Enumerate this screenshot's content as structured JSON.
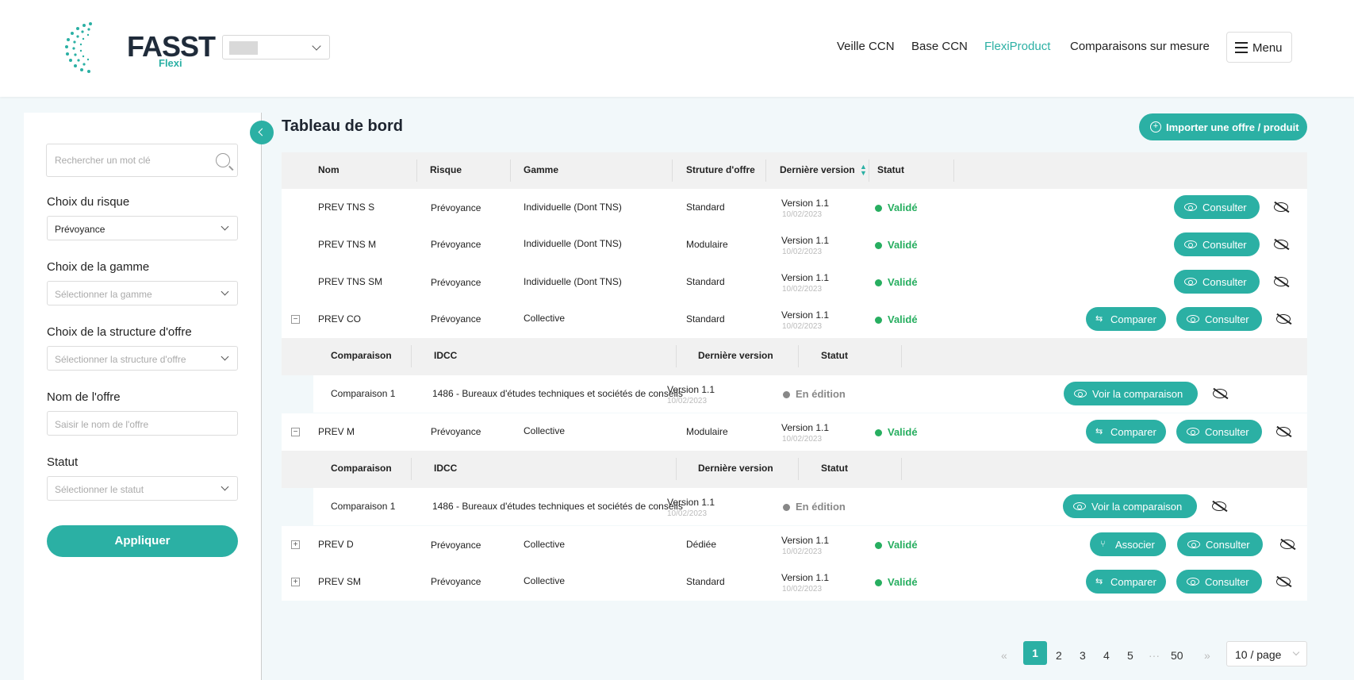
{
  "header": {
    "logo_text": "FASST",
    "logo_sub": "Flexi",
    "nav": [
      "Veille CCN",
      "Base CCN",
      "FlexiProduct",
      "Comparaisons sur mesure"
    ],
    "menu_label": "Menu",
    "accent_color": "#2bb0a4"
  },
  "sidebar": {
    "search_placeholder": "Rechercher un mot clé",
    "risk_label": "Choix du risque",
    "risk_value": "Prévoyance",
    "gamme_label": "Choix de la gamme",
    "gamme_placeholder": "Sélectionner la gamme",
    "structure_label": "Choix de la structure d'offre",
    "structure_placeholder": "Sélectionner la structure d'offre",
    "name_label": "Nom de l'offre",
    "name_placeholder": "Saisir le nom de l'offre",
    "status_label": "Statut",
    "status_placeholder": "Sélectionner le statut",
    "apply_label": "Appliquer"
  },
  "main": {
    "title": "Tableau de bord",
    "import_label": "Importer une offre / produit",
    "columns": [
      "Nom",
      "Risque",
      "Gamme",
      "Struture d'offre",
      "Dernière version",
      "Statut"
    ],
    "sub_columns": [
      "Comparaison",
      "IDCC",
      "Dernière version",
      "Statut"
    ],
    "rows": [
      {
        "name": "PREV TNS S",
        "risk": "Prévoyance",
        "gamme": "Individuelle (Dont TNS)",
        "structure": "Standard",
        "version": "Version 1.1",
        "date": "10/02/2023",
        "status": "Validé"
      },
      {
        "name": "PREV TNS M",
        "risk": "Prévoyance",
        "gamme": "Individuelle (Dont TNS)",
        "structure": "Modulaire",
        "version": "Version 1.1",
        "date": "10/02/2023",
        "status": "Validé"
      },
      {
        "name": "PREV TNS SM",
        "risk": "Prévoyance",
        "gamme": "Individuelle (Dont TNS)",
        "structure": "Standard",
        "version": "Version 1.1",
        "date": "10/02/2023",
        "status": "Validé"
      },
      {
        "name": "PREV CO",
        "risk": "Prévoyance",
        "gamme": "Collective",
        "structure": "Standard",
        "version": "Version 1.1",
        "date": "10/02/2023",
        "status": "Validé"
      },
      {
        "name": "PREV M",
        "risk": "Prévoyance",
        "gamme": "Collective",
        "structure": "Modulaire",
        "version": "Version 1.1",
        "date": "10/02/2023",
        "status": "Validé"
      },
      {
        "name": "PREV D",
        "risk": "Prévoyance",
        "gamme": "Collective",
        "structure": "Dédiée",
        "version": "Version 1.1",
        "date": "10/02/2023",
        "status": "Validé"
      },
      {
        "name": "PREV SM",
        "risk": "Prévoyance",
        "gamme": "Collective",
        "structure": "Standard",
        "version": "Version 1.1",
        "date": "10/02/2023",
        "status": "Validé"
      }
    ],
    "comparison": {
      "name": "Comparaison 1",
      "idcc": "1486 - Bureaux d'études techniques et sociétés de conseils",
      "version": "Version 1.1",
      "date": "10/02/2023",
      "status": "En édition"
    },
    "buttons": {
      "consult": "Consulter",
      "compare": "Comparer",
      "associate": "Associer",
      "view_comparison": "Voir la comparaison"
    },
    "expander_minus": "−",
    "expander_plus": "+"
  },
  "pagination": {
    "prev": "«",
    "next": "»",
    "ellipsis": "···",
    "pages": [
      "1",
      "2",
      "3",
      "4",
      "5",
      "50"
    ],
    "page_size": "10 / page"
  }
}
